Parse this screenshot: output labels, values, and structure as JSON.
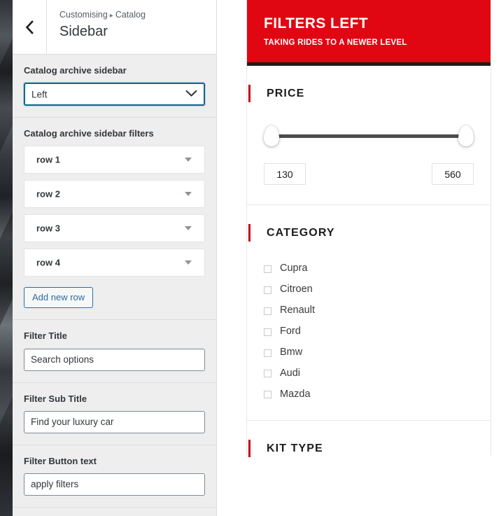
{
  "customizer": {
    "back_icon": "chevron-left-icon",
    "breadcrumb_parent": "Customising",
    "breadcrumb_separator": "▸",
    "breadcrumb_current": "Catalog",
    "panel_title": "Sidebar",
    "sidebar_position": {
      "label": "Catalog archive sidebar",
      "value": "Left",
      "chevron_icon": "chevron-down-icon"
    },
    "filters_group": {
      "label": "Catalog archive sidebar filters",
      "rows": [
        {
          "label": "row 1",
          "caret_icon": "caret-down-icon"
        },
        {
          "label": "row 2",
          "caret_icon": "caret-down-icon"
        },
        {
          "label": "row 3",
          "caret_icon": "caret-down-icon"
        },
        {
          "label": "row 4",
          "caret_icon": "caret-down-icon"
        }
      ],
      "add_row_label": "Add new row"
    },
    "fields": [
      {
        "label": "Filter Title",
        "value": "Search options"
      },
      {
        "label": "Filter Sub Title",
        "value": "Find your luxury car"
      },
      {
        "label": "Filter Button text",
        "value": "apply filters"
      }
    ]
  },
  "preview": {
    "header": {
      "title": "FILTERS LEFT",
      "subtitle": "TAKING RIDES TO A NEWER LEVEL",
      "bg_color": "#e00713",
      "rule_color": "#1c1c1c"
    },
    "price": {
      "title": "PRICE",
      "accent_color": "#c20612",
      "min_value": "130",
      "max_value": "560",
      "handle_left_name": "slider-handle-min",
      "handle_right_name": "slider-handle-max"
    },
    "category": {
      "title": "CATEGORY",
      "items": [
        "Cupra",
        "Citroen",
        "Renault",
        "Ford",
        "Bmw",
        "Audi",
        "Mazda"
      ]
    },
    "next_section": {
      "title": "KIT TYPE"
    }
  }
}
